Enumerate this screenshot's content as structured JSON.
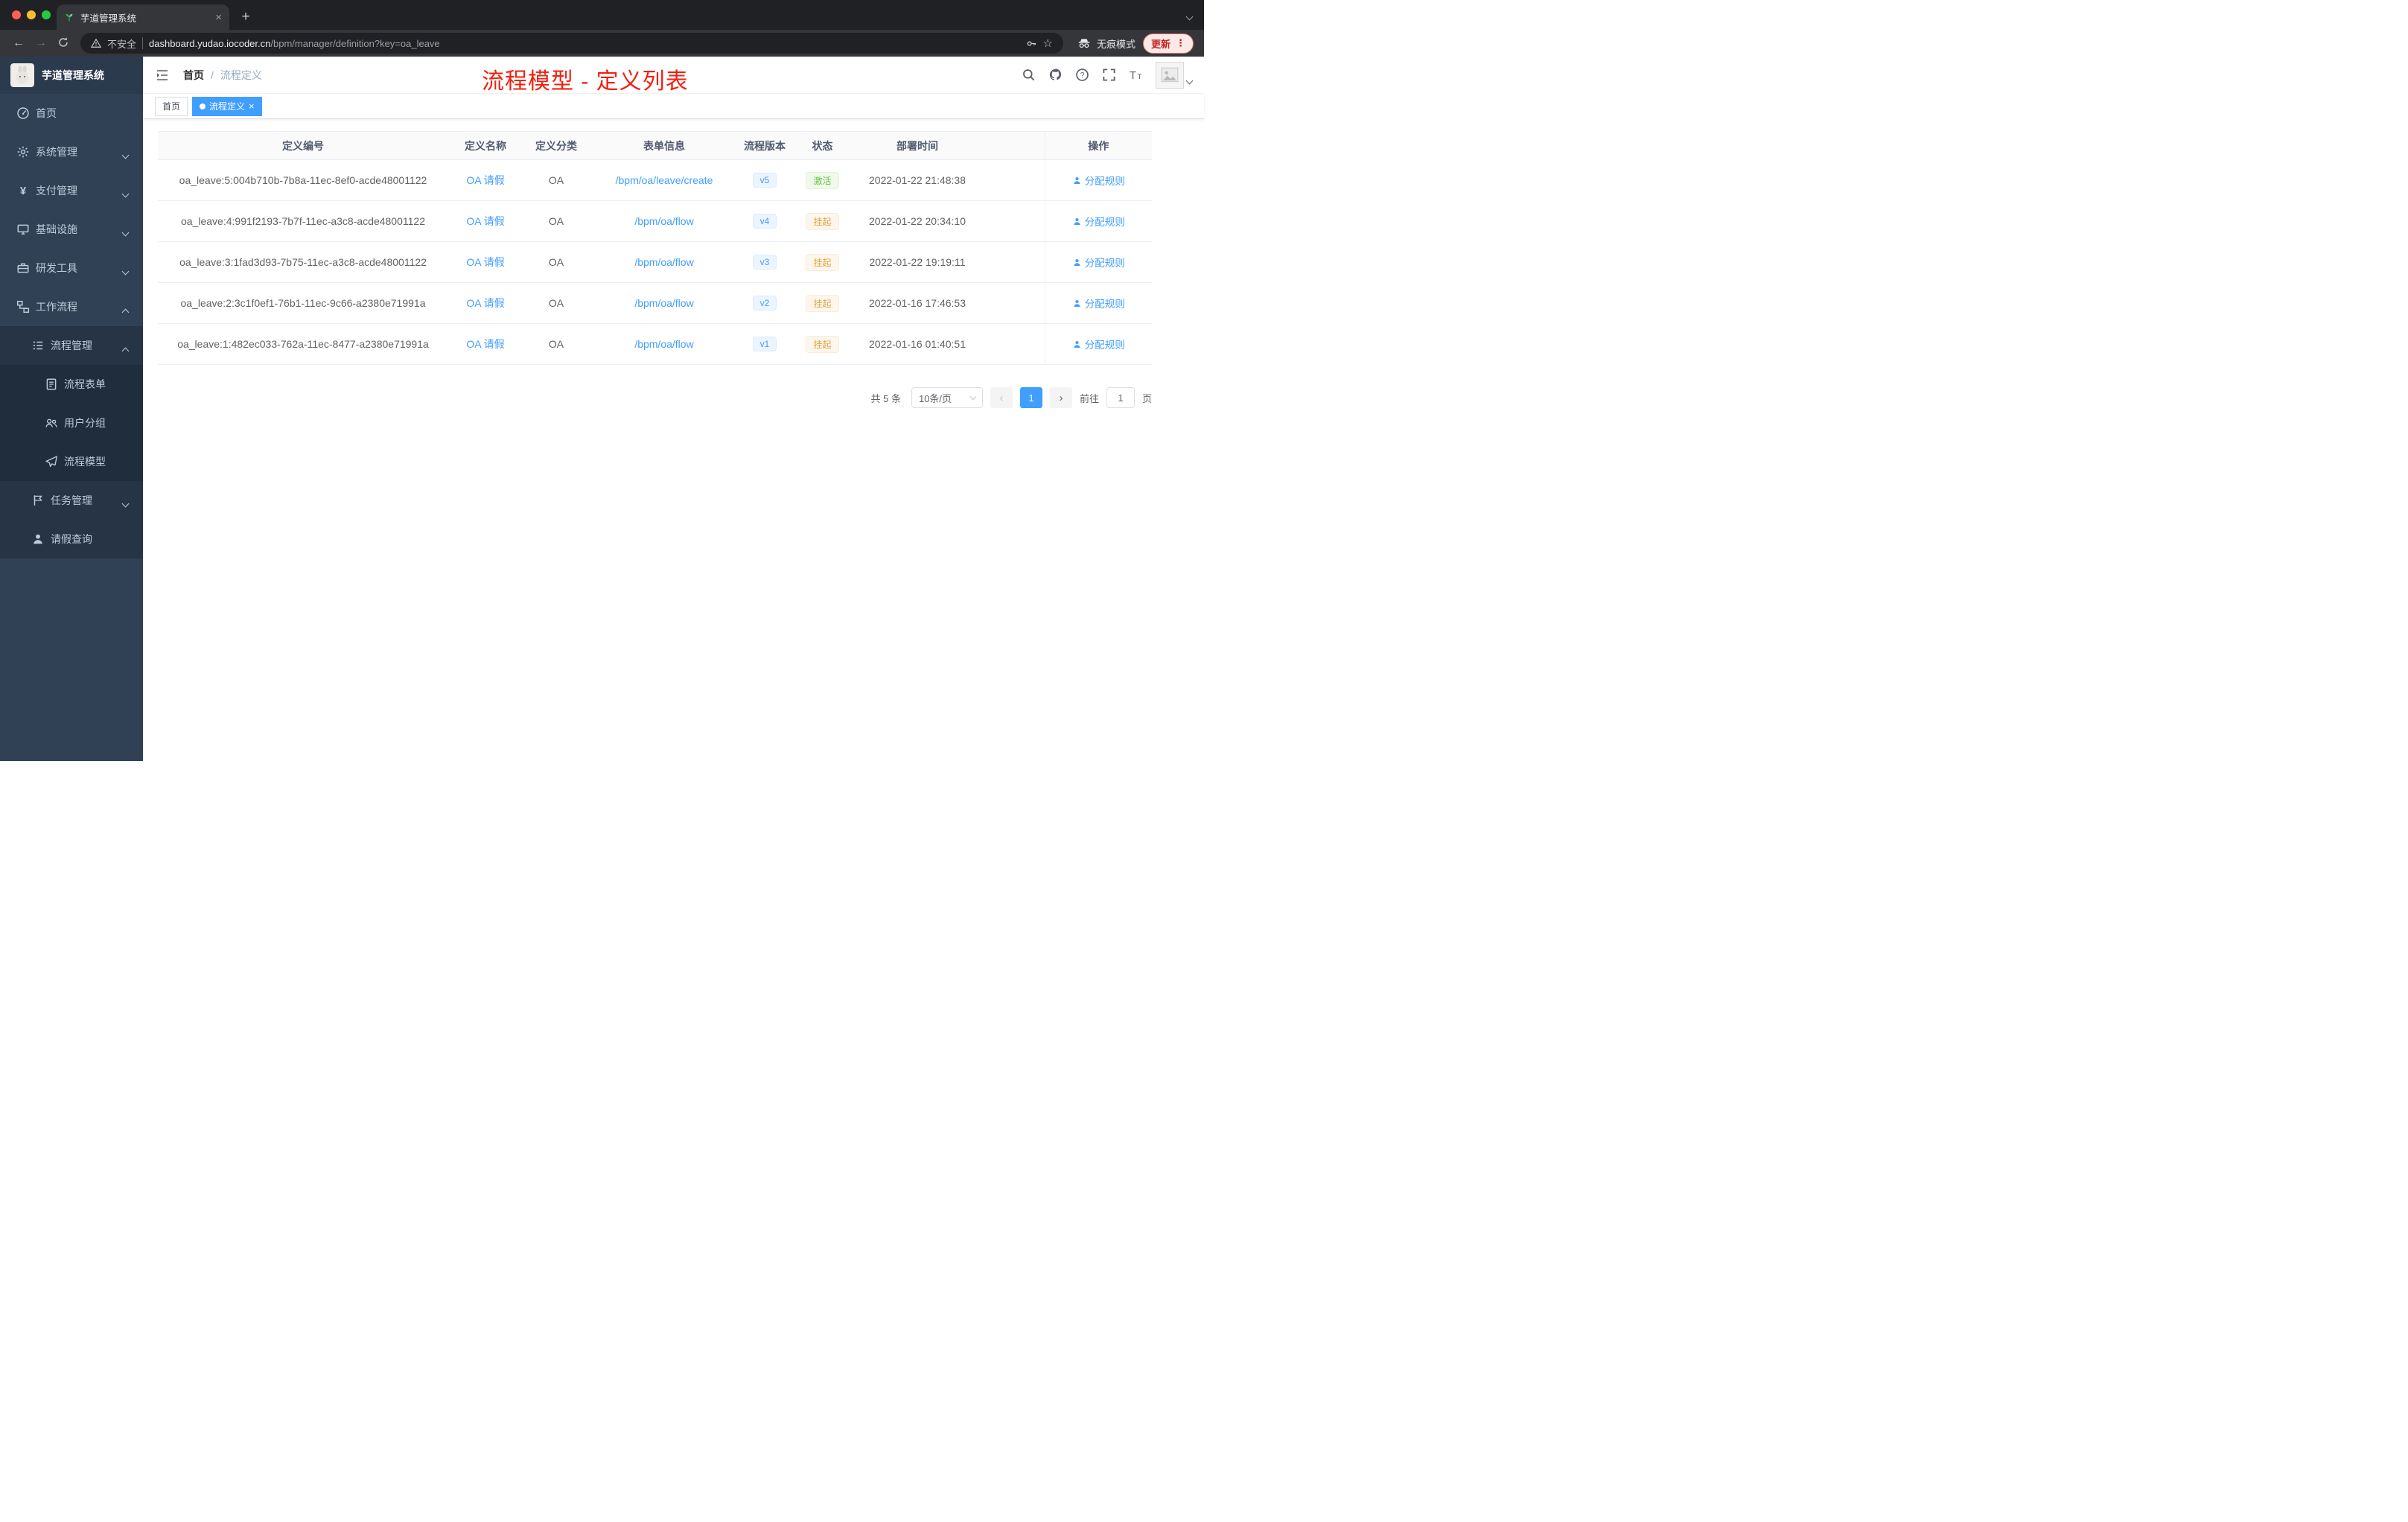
{
  "browser": {
    "tab": {
      "title": "芋道管理系统"
    },
    "toolbar": {
      "security_label": "不安全",
      "url_domain": "dashboard.yudao.iocoder.cn",
      "url_path": "/bpm/manager/definition?key=oa_leave",
      "incognito_label": "无痕模式",
      "update_label": "更新"
    }
  },
  "glyphs": {
    "close": "×",
    "plus": "+",
    "back": "←",
    "forward": "→",
    "star": "☆",
    "kebab": "⋮",
    "yen": "¥",
    "prev": "‹",
    "next": "›",
    "breadcrumb_sep": "/"
  },
  "sidebar": {
    "logo_title": "芋道管理系统",
    "menu": [
      {
        "label": "首页"
      },
      {
        "label": "系统管理"
      },
      {
        "label": "支付管理"
      },
      {
        "label": "基础设施"
      },
      {
        "label": "研发工具"
      },
      {
        "label": "工作流程"
      },
      {
        "label": "流程管理"
      },
      {
        "label": "流程表单"
      },
      {
        "label": "用户分组"
      },
      {
        "label": "流程模型"
      },
      {
        "label": "任务管理"
      },
      {
        "label": "请假查询"
      }
    ]
  },
  "header": {
    "breadcrumb": {
      "home": "首页",
      "current": "流程定义"
    },
    "annotation": "流程模型 - 定义列表"
  },
  "tags": {
    "home": "首页",
    "active": "流程定义"
  },
  "table": {
    "columns": [
      "定义编号",
      "定义名称",
      "定义分类",
      "表单信息",
      "流程版本",
      "状态",
      "部署时间",
      "操作"
    ],
    "rows": [
      {
        "id": "oa_leave:5:004b710b-7b8a-11ec-8ef0-acde48001122",
        "name": "OA 请假",
        "category": "OA",
        "form": "/bpm/oa/leave/create",
        "version": "v5",
        "status": "激活",
        "time": "2022-01-22 21:48:38",
        "action": "分配规则"
      },
      {
        "id": "oa_leave:4:991f2193-7b7f-11ec-a3c8-acde48001122",
        "name": "OA 请假",
        "category": "OA",
        "form": "/bpm/oa/flow",
        "version": "v4",
        "status": "挂起",
        "time": "2022-01-22 20:34:10",
        "action": "分配规则"
      },
      {
        "id": "oa_leave:3:1fad3d93-7b75-11ec-a3c8-acde48001122",
        "name": "OA 请假",
        "category": "OA",
        "form": "/bpm/oa/flow",
        "version": "v3",
        "status": "挂起",
        "time": "2022-01-22 19:19:11",
        "action": "分配规则"
      },
      {
        "id": "oa_leave:2:3c1f0ef1-76b1-11ec-9c66-a2380e71991a",
        "name": "OA 请假",
        "category": "OA",
        "form": "/bpm/oa/flow",
        "version": "v2",
        "status": "挂起",
        "time": "2022-01-16 17:46:53",
        "action": "分配规则"
      },
      {
        "id": "oa_leave:1:482ec033-762a-11ec-8477-a2380e71991a",
        "name": "OA 请假",
        "category": "OA",
        "form": "/bpm/oa/flow",
        "version": "v1",
        "status": "挂起",
        "time": "2022-01-16 01:40:51",
        "action": "分配规则"
      }
    ]
  },
  "pagination": {
    "total": "共 5 条",
    "page_size": "10条/页",
    "page": "1",
    "goto_label": "前往",
    "goto_value": "1",
    "unit_label": "页"
  }
}
